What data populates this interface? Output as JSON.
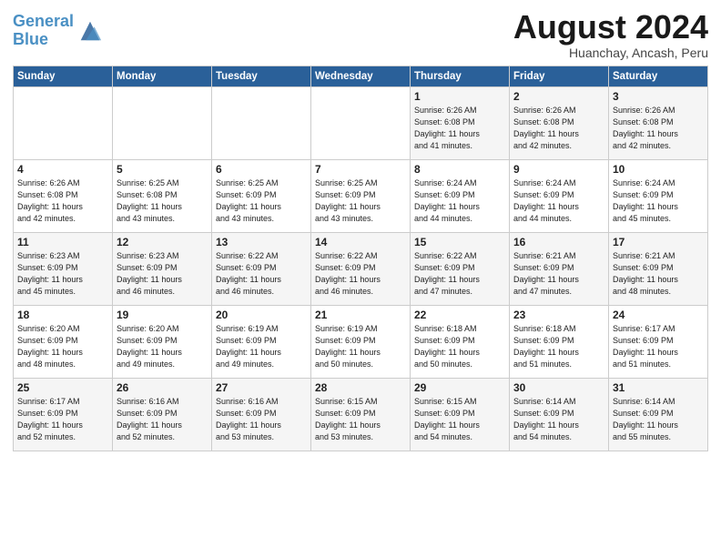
{
  "header": {
    "logo_line1": "General",
    "logo_line2": "Blue",
    "title": "August 2024",
    "location": "Huanchay, Ancash, Peru"
  },
  "weekdays": [
    "Sunday",
    "Monday",
    "Tuesday",
    "Wednesday",
    "Thursday",
    "Friday",
    "Saturday"
  ],
  "weeks": [
    [
      {
        "day": "",
        "info": ""
      },
      {
        "day": "",
        "info": ""
      },
      {
        "day": "",
        "info": ""
      },
      {
        "day": "",
        "info": ""
      },
      {
        "day": "1",
        "info": "Sunrise: 6:26 AM\nSunset: 6:08 PM\nDaylight: 11 hours\nand 41 minutes."
      },
      {
        "day": "2",
        "info": "Sunrise: 6:26 AM\nSunset: 6:08 PM\nDaylight: 11 hours\nand 42 minutes."
      },
      {
        "day": "3",
        "info": "Sunrise: 6:26 AM\nSunset: 6:08 PM\nDaylight: 11 hours\nand 42 minutes."
      }
    ],
    [
      {
        "day": "4",
        "info": "Sunrise: 6:26 AM\nSunset: 6:08 PM\nDaylight: 11 hours\nand 42 minutes."
      },
      {
        "day": "5",
        "info": "Sunrise: 6:25 AM\nSunset: 6:08 PM\nDaylight: 11 hours\nand 43 minutes."
      },
      {
        "day": "6",
        "info": "Sunrise: 6:25 AM\nSunset: 6:09 PM\nDaylight: 11 hours\nand 43 minutes."
      },
      {
        "day": "7",
        "info": "Sunrise: 6:25 AM\nSunset: 6:09 PM\nDaylight: 11 hours\nand 43 minutes."
      },
      {
        "day": "8",
        "info": "Sunrise: 6:24 AM\nSunset: 6:09 PM\nDaylight: 11 hours\nand 44 minutes."
      },
      {
        "day": "9",
        "info": "Sunrise: 6:24 AM\nSunset: 6:09 PM\nDaylight: 11 hours\nand 44 minutes."
      },
      {
        "day": "10",
        "info": "Sunrise: 6:24 AM\nSunset: 6:09 PM\nDaylight: 11 hours\nand 45 minutes."
      }
    ],
    [
      {
        "day": "11",
        "info": "Sunrise: 6:23 AM\nSunset: 6:09 PM\nDaylight: 11 hours\nand 45 minutes."
      },
      {
        "day": "12",
        "info": "Sunrise: 6:23 AM\nSunset: 6:09 PM\nDaylight: 11 hours\nand 46 minutes."
      },
      {
        "day": "13",
        "info": "Sunrise: 6:22 AM\nSunset: 6:09 PM\nDaylight: 11 hours\nand 46 minutes."
      },
      {
        "day": "14",
        "info": "Sunrise: 6:22 AM\nSunset: 6:09 PM\nDaylight: 11 hours\nand 46 minutes."
      },
      {
        "day": "15",
        "info": "Sunrise: 6:22 AM\nSunset: 6:09 PM\nDaylight: 11 hours\nand 47 minutes."
      },
      {
        "day": "16",
        "info": "Sunrise: 6:21 AM\nSunset: 6:09 PM\nDaylight: 11 hours\nand 47 minutes."
      },
      {
        "day": "17",
        "info": "Sunrise: 6:21 AM\nSunset: 6:09 PM\nDaylight: 11 hours\nand 48 minutes."
      }
    ],
    [
      {
        "day": "18",
        "info": "Sunrise: 6:20 AM\nSunset: 6:09 PM\nDaylight: 11 hours\nand 48 minutes."
      },
      {
        "day": "19",
        "info": "Sunrise: 6:20 AM\nSunset: 6:09 PM\nDaylight: 11 hours\nand 49 minutes."
      },
      {
        "day": "20",
        "info": "Sunrise: 6:19 AM\nSunset: 6:09 PM\nDaylight: 11 hours\nand 49 minutes."
      },
      {
        "day": "21",
        "info": "Sunrise: 6:19 AM\nSunset: 6:09 PM\nDaylight: 11 hours\nand 50 minutes."
      },
      {
        "day": "22",
        "info": "Sunrise: 6:18 AM\nSunset: 6:09 PM\nDaylight: 11 hours\nand 50 minutes."
      },
      {
        "day": "23",
        "info": "Sunrise: 6:18 AM\nSunset: 6:09 PM\nDaylight: 11 hours\nand 51 minutes."
      },
      {
        "day": "24",
        "info": "Sunrise: 6:17 AM\nSunset: 6:09 PM\nDaylight: 11 hours\nand 51 minutes."
      }
    ],
    [
      {
        "day": "25",
        "info": "Sunrise: 6:17 AM\nSunset: 6:09 PM\nDaylight: 11 hours\nand 52 minutes."
      },
      {
        "day": "26",
        "info": "Sunrise: 6:16 AM\nSunset: 6:09 PM\nDaylight: 11 hours\nand 52 minutes."
      },
      {
        "day": "27",
        "info": "Sunrise: 6:16 AM\nSunset: 6:09 PM\nDaylight: 11 hours\nand 53 minutes."
      },
      {
        "day": "28",
        "info": "Sunrise: 6:15 AM\nSunset: 6:09 PM\nDaylight: 11 hours\nand 53 minutes."
      },
      {
        "day": "29",
        "info": "Sunrise: 6:15 AM\nSunset: 6:09 PM\nDaylight: 11 hours\nand 54 minutes."
      },
      {
        "day": "30",
        "info": "Sunrise: 6:14 AM\nSunset: 6:09 PM\nDaylight: 11 hours\nand 54 minutes."
      },
      {
        "day": "31",
        "info": "Sunrise: 6:14 AM\nSunset: 6:09 PM\nDaylight: 11 hours\nand 55 minutes."
      }
    ]
  ]
}
